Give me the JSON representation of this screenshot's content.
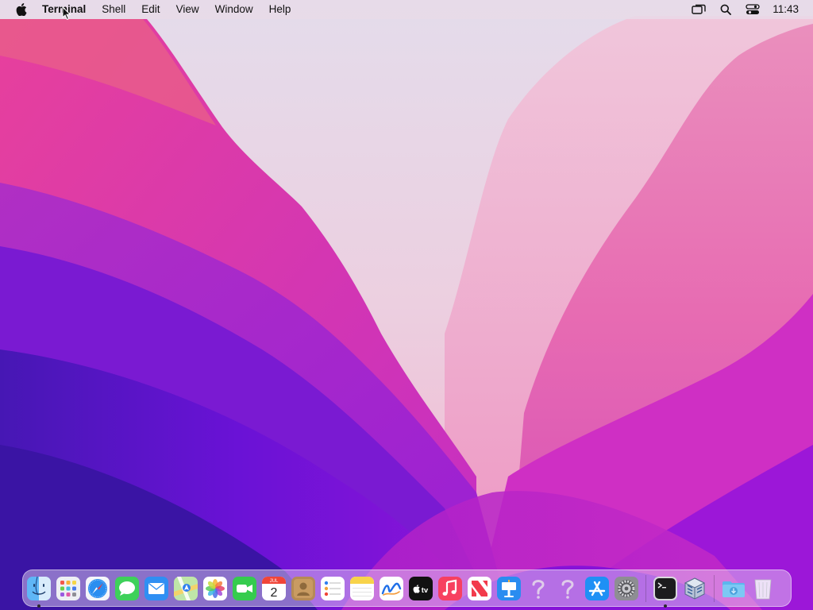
{
  "menubar": {
    "app_name": "Terminal",
    "menus": [
      "Shell",
      "Edit",
      "View",
      "Window",
      "Help"
    ],
    "clock": "11:43",
    "status_icons": [
      "screen-mirroring-icon",
      "search-icon",
      "control-center-icon"
    ]
  },
  "dock": {
    "apps": [
      {
        "name": "Finder",
        "icon": "finder-icon",
        "running": true
      },
      {
        "name": "Launchpad",
        "icon": "launchpad-icon",
        "running": false
      },
      {
        "name": "Safari",
        "icon": "safari-icon",
        "running": false
      },
      {
        "name": "Messages",
        "icon": "messages-icon",
        "running": false
      },
      {
        "name": "Mail",
        "icon": "mail-icon",
        "running": false
      },
      {
        "name": "Maps",
        "icon": "maps-icon",
        "running": false
      },
      {
        "name": "Photos",
        "icon": "photos-icon",
        "running": false
      },
      {
        "name": "FaceTime",
        "icon": "facetime-icon",
        "running": false
      },
      {
        "name": "Calendar",
        "icon": "calendar-icon",
        "running": false,
        "month": "JUL",
        "day": "2"
      },
      {
        "name": "Contacts",
        "icon": "contacts-icon",
        "running": false
      },
      {
        "name": "Reminders",
        "icon": "reminders-icon",
        "running": false
      },
      {
        "name": "Notes",
        "icon": "notes-icon",
        "running": false
      },
      {
        "name": "Freeform",
        "icon": "freeform-icon",
        "running": false
      },
      {
        "name": "TV",
        "icon": "apple-tv-icon",
        "running": false,
        "label": "tv"
      },
      {
        "name": "Music",
        "icon": "music-icon",
        "running": false
      },
      {
        "name": "News",
        "icon": "news-icon",
        "running": false
      },
      {
        "name": "Keynote",
        "icon": "keynote-icon",
        "running": false
      },
      {
        "name": "Unknown",
        "icon": "question-mark-icon",
        "running": false
      },
      {
        "name": "Unknown",
        "icon": "question-mark-icon",
        "running": false
      },
      {
        "name": "App Store",
        "icon": "app-store-icon",
        "running": false
      },
      {
        "name": "System Preferences",
        "icon": "system-preferences-icon",
        "running": false
      }
    ],
    "other_apps": [
      {
        "name": "Terminal",
        "icon": "terminal-icon",
        "running": true
      },
      {
        "name": "VirtualBox",
        "icon": "virtualbox-icon",
        "running": false
      }
    ],
    "stacks": [
      {
        "name": "Downloads",
        "icon": "downloads-folder-icon"
      },
      {
        "name": "Trash",
        "icon": "trash-icon"
      }
    ]
  },
  "colors": {
    "wallpaper_light": "#e6ddea",
    "wallpaper_pink": "#d9389e",
    "wallpaper_purple": "#6a1fd0",
    "wallpaper_deep": "#3a12a8"
  }
}
